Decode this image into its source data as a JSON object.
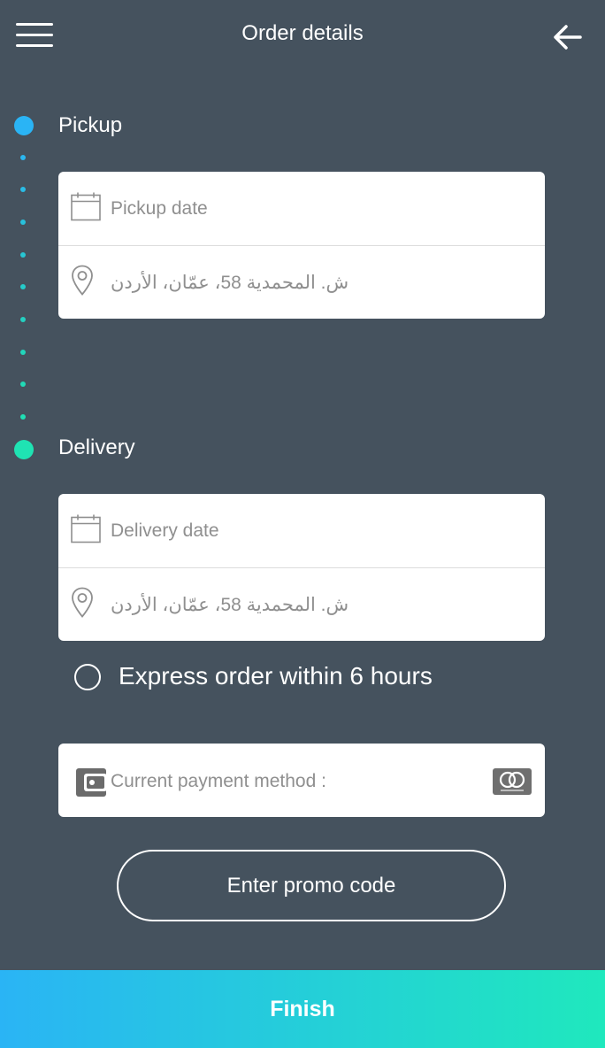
{
  "header": {
    "title": "Order details",
    "menu_icon": "hamburger-menu-icon",
    "back_icon": "arrow-left-icon"
  },
  "pickup": {
    "label": "Pickup",
    "date_placeholder": "Pickup date",
    "address": "ش. المحمدية 58، عمّان، الأردن",
    "color": "#2ab4f5"
  },
  "delivery": {
    "label": "Delivery",
    "date_placeholder": "Delivery date",
    "address": "ش. المحمدية 58، عمّان، الأردن",
    "color": "#1fe3b3"
  },
  "express": {
    "label": "Express order within 6 hours",
    "checked": false
  },
  "payment": {
    "label": "Current payment method :",
    "wallet_icon": "wallet-icon",
    "brand_icon": "mastercard-icon"
  },
  "promo": {
    "label": "Enter promo code"
  },
  "footer": {
    "finish_label": "Finish"
  },
  "colors": {
    "background": "#45525e",
    "accent_start": "#2ab4f5",
    "accent_end": "#1fe8bd"
  }
}
